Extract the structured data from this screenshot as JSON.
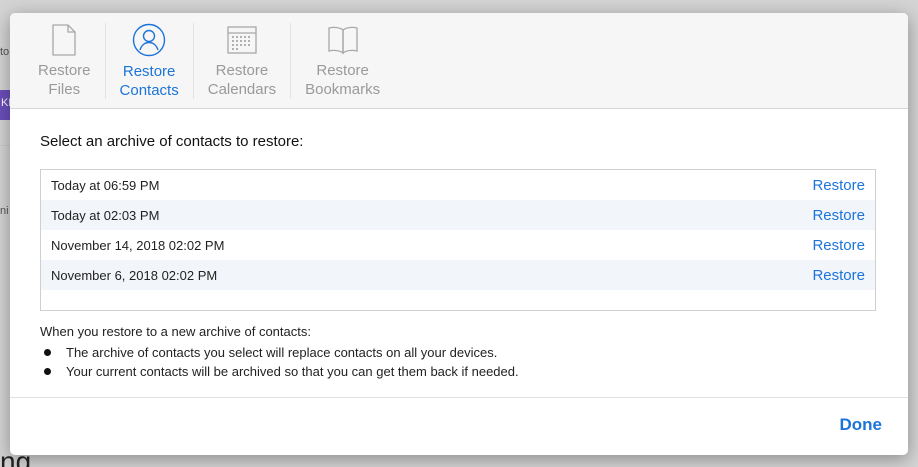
{
  "background": {
    "frag_a": "to",
    "frag_b": "ni",
    "purple_tab": "KL",
    "big_text": "ng"
  },
  "toolbar": {
    "tabs": [
      {
        "label": "Restore\nFiles",
        "icon": "file-icon",
        "active": false
      },
      {
        "label": "Restore\nContacts",
        "icon": "contacts-icon",
        "active": true
      },
      {
        "label": "Restore\nCalendars",
        "icon": "calendar-icon",
        "active": false
      },
      {
        "label": "Restore\nBookmarks",
        "icon": "book-icon",
        "active": false
      }
    ]
  },
  "main": {
    "heading": "Select an archive of contacts to restore:",
    "archives": [
      {
        "date": "Today at 06:59 PM",
        "action": "Restore"
      },
      {
        "date": "Today at 02:03 PM",
        "action": "Restore"
      },
      {
        "date": "November 14, 2018 02:02 PM",
        "action": "Restore"
      },
      {
        "date": "November 6, 2018 02:02 PM",
        "action": "Restore"
      }
    ],
    "notes_heading": "When you restore to a new archive of contacts:",
    "notes": [
      "The archive of contacts you select will replace contacts on all your devices.",
      "Your current contacts will be archived so that you can get them back if needed."
    ]
  },
  "footer": {
    "done_label": "Done"
  },
  "colors": {
    "accent": "#1d74d8",
    "inactive": "#9a9a9a"
  }
}
